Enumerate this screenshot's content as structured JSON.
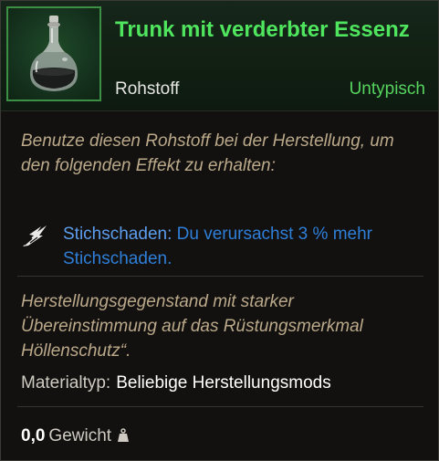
{
  "item": {
    "title": "Trunk mit verderbter Essenz",
    "type": "Rohstoff",
    "rarity": "Untypisch",
    "icon": "corrupted-essence-flask-icon"
  },
  "description": "Benutze diesen Rohstoff bei der Herstellung, um den folgenden Effekt zu erhalten:",
  "effect": {
    "icon": "thrust-damage-icon",
    "name": "Stichschaden:",
    "text": " Du verursachst 3 % mehr Stichschaden."
  },
  "flavor": "Herstellungsgegenstand mit starker Übereinstimmung auf das Rüstungsmerkmal Höllenschutz“.",
  "material": {
    "label": "Materialtyp:",
    "value": "Beliebige Herstellungsmods"
  },
  "weight": {
    "value": "0,0",
    "label": "Gewicht",
    "icon": "weight-icon"
  },
  "colors": {
    "title_green": "#4fe55e",
    "rarity_green": "#56d45e",
    "effect_blue": "#2f7fd8",
    "italic_tan": "#bba98a",
    "frame_green": "#3e8f46"
  }
}
